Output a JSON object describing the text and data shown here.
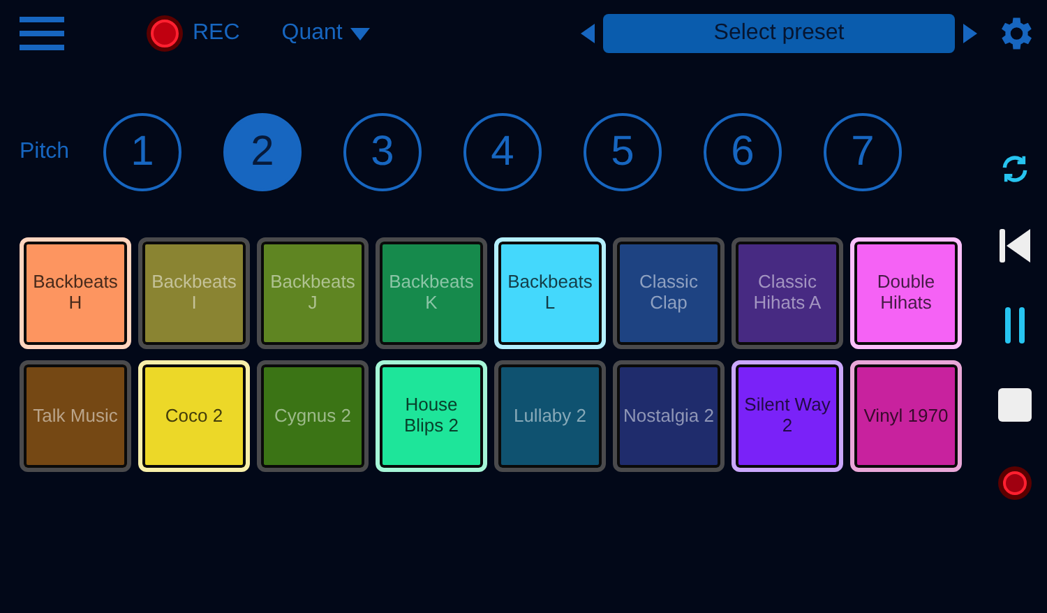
{
  "toolbar": {
    "rec_label": "REC",
    "quant_label": "Quant",
    "preset": "Select preset"
  },
  "pitch": {
    "label": "Pitch",
    "options": [
      {
        "label": "1",
        "selected": false
      },
      {
        "label": "2",
        "selected": true
      },
      {
        "label": "3",
        "selected": false
      },
      {
        "label": "4",
        "selected": false
      },
      {
        "label": "5",
        "selected": false
      },
      {
        "label": "6",
        "selected": false
      },
      {
        "label": "7",
        "selected": false
      }
    ]
  },
  "pads": [
    {
      "label": "Backbeats H",
      "color": "#fd9560",
      "active": true
    },
    {
      "label": "Backbeats I",
      "color": "#8a8432",
      "active": false
    },
    {
      "label": "Backbeats J",
      "color": "#5f8522",
      "active": false
    },
    {
      "label": "Backbeats K",
      "color": "#168a4c",
      "active": false
    },
    {
      "label": "Backbeats L",
      "color": "#44d8fc",
      "active": true
    },
    {
      "label": "Classic Clap",
      "color": "#1e4382",
      "active": false
    },
    {
      "label": "Classic Hihats A",
      "color": "#472a82",
      "active": false
    },
    {
      "label": "Double Hihats",
      "color": "#f562f5",
      "active": true
    },
    {
      "label": "Talk Music",
      "color": "#754814",
      "active": false
    },
    {
      "label": "Coco 2",
      "color": "#ecd828",
      "active": true
    },
    {
      "label": "Cygnus 2",
      "color": "#3b7415",
      "active": false
    },
    {
      "label": "House Blips 2",
      "color": "#1ee59a",
      "active": true
    },
    {
      "label": "Lullaby 2",
      "color": "#0f5270",
      "active": false
    },
    {
      "label": "Nostalgia 2",
      "color": "#1f2c6c",
      "active": false
    },
    {
      "label": "Silent Way 2",
      "color": "#7a22f8",
      "active": true
    },
    {
      "label": "Vinyl 1970",
      "color": "#c8229e",
      "active": true
    }
  ]
}
